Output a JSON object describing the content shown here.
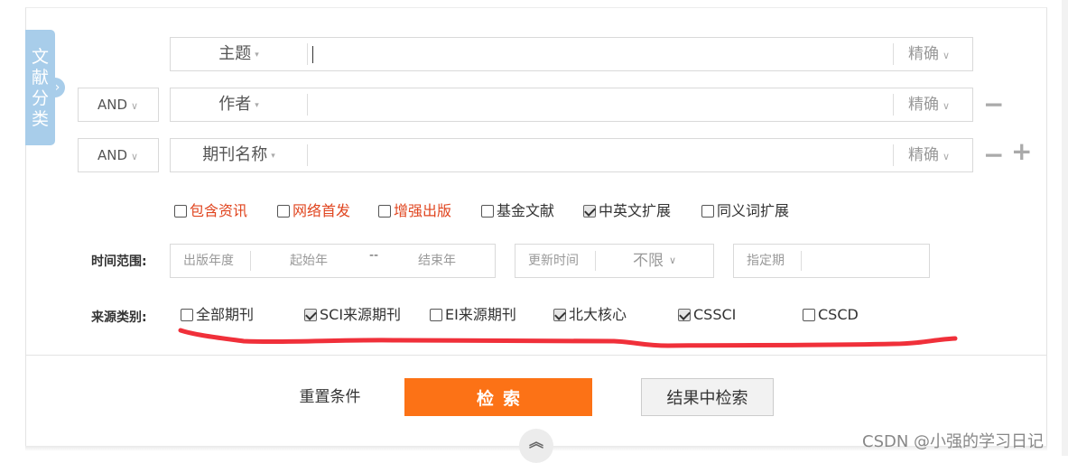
{
  "side_tab": {
    "chars": [
      "文",
      "献",
      "分",
      "类"
    ]
  },
  "search_rows": [
    {
      "logic": "",
      "field": "主题",
      "value": "",
      "precision": "精确"
    },
    {
      "logic": "AND",
      "field": "作者",
      "value": "",
      "precision": "精确",
      "op_minus": "−"
    },
    {
      "logic": "AND",
      "field": "期刊名称",
      "value": "",
      "precision": "精确",
      "op_minus": "−",
      "op_plus": "+"
    }
  ],
  "options": [
    {
      "label": "包含资讯",
      "checked": false,
      "color": "red"
    },
    {
      "label": "网络首发",
      "checked": false,
      "color": "red"
    },
    {
      "label": "增强出版",
      "checked": false,
      "color": "red"
    },
    {
      "label": "基金文献",
      "checked": false,
      "color": "dark"
    },
    {
      "label": "中英文扩展",
      "checked": true,
      "color": "dark"
    },
    {
      "label": "同义词扩展",
      "checked": false,
      "color": "dark"
    }
  ],
  "time_range": {
    "label": "时间范围:",
    "pub_year": "出版年度",
    "start_year": "起始年",
    "dash": "--",
    "end_year": "结束年",
    "update_time": "更新时间",
    "update_value": "不限",
    "issue": "指定期"
  },
  "source": {
    "label": "来源类别:",
    "items": [
      {
        "label": "全部期刊",
        "checked": false
      },
      {
        "label": "SCI来源期刊",
        "checked": true
      },
      {
        "label": "EI来源期刊",
        "checked": false
      },
      {
        "label": "北大核心",
        "checked": true
      },
      {
        "label": "CSSCI",
        "checked": true
      },
      {
        "label": "CSCD",
        "checked": false
      }
    ]
  },
  "buttons": {
    "reset": "重置条件",
    "search": "检索",
    "in_result": "结果中检索"
  },
  "collapse_icon": "double-chevron-up-icon",
  "watermark": "CSDN @小强的学习日记",
  "colors": {
    "accent": "#fc7216",
    "side_tab": "#a8cdea",
    "annotation": "#f0303a",
    "red_text": "#e0451f"
  }
}
